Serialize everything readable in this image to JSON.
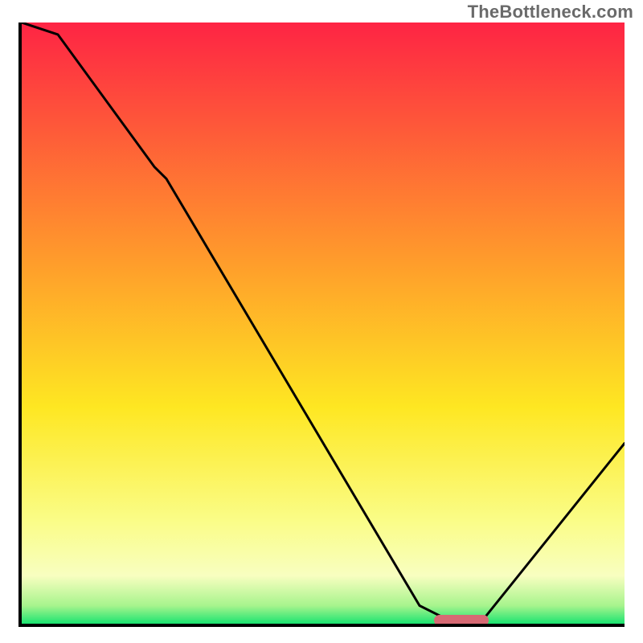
{
  "watermark": "TheBottleneck.com",
  "colors": {
    "red": "#fe2444",
    "orange": "#ff9d2b",
    "yellow_mid": "#fee722",
    "yellow_pale": "#fafd88",
    "cream": "#f8fec0",
    "green": "#1be471",
    "curve": "#000000",
    "marker": "#d76a74",
    "axis": "#000000"
  },
  "chart_data": {
    "type": "line",
    "title": "",
    "xlabel": "",
    "ylabel": "",
    "xlim": [
      0,
      100
    ],
    "ylim": [
      0,
      100
    ],
    "x": [
      0,
      6,
      22,
      24,
      66,
      72,
      76,
      100
    ],
    "values": [
      100,
      98,
      76,
      74,
      3,
      0,
      0,
      30
    ],
    "optimal_range_x": [
      68,
      77
    ],
    "gradient_stops": [
      {
        "pos": 0.0,
        "color": "#fe2444"
      },
      {
        "pos": 0.4,
        "color": "#ff9d2b"
      },
      {
        "pos": 0.64,
        "color": "#fee722"
      },
      {
        "pos": 0.83,
        "color": "#fafd88"
      },
      {
        "pos": 0.92,
        "color": "#f8fec0"
      },
      {
        "pos": 0.97,
        "color": "#a7f48d"
      },
      {
        "pos": 1.0,
        "color": "#1be471"
      }
    ]
  }
}
